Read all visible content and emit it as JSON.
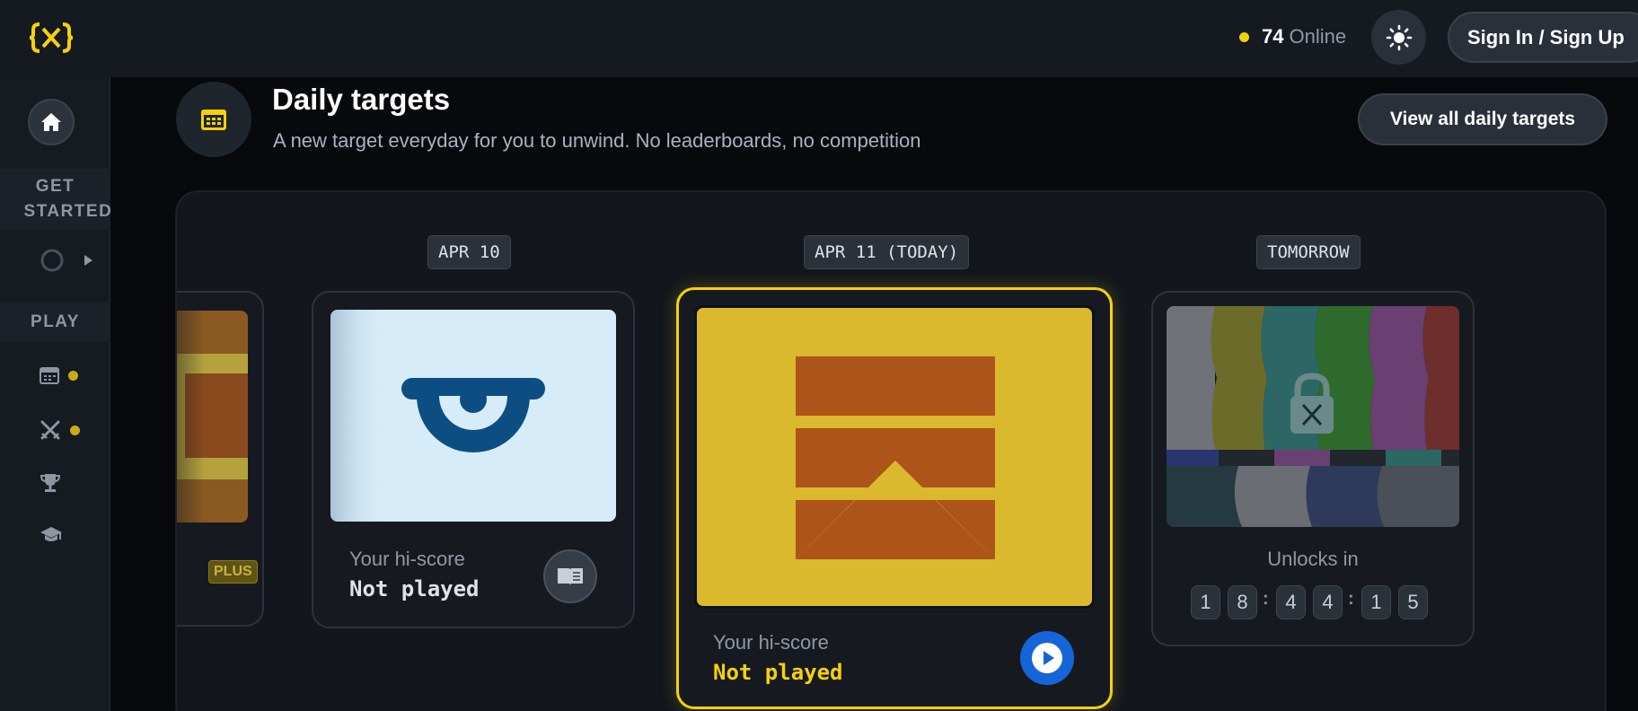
{
  "topbar": {
    "logo_alt": "{X}",
    "online_count": "74",
    "online_label": "Online",
    "signin_label": "Sign In / Sign Up"
  },
  "sidebar": {
    "get_started_label": "GET STARTED",
    "play_label": "PLAY"
  },
  "header": {
    "title": "Daily targets",
    "subtitle": "A new target everyday for you to unwind. No leaderboards, no competition",
    "view_all_label": "View all daily targets"
  },
  "cards": {
    "prev": {
      "badge": "PLUS"
    },
    "apr10": {
      "date": "APR 10",
      "score_label": "Your hi-score",
      "score_value": "Not played"
    },
    "today": {
      "date": "APR 11 (TODAY)",
      "score_label": "Your hi-score",
      "score_value": "Not played"
    },
    "tomorrow": {
      "date": "TOMORROW",
      "unlock_label": "Unlocks in",
      "digits": [
        "1",
        "8",
        "4",
        "4",
        "1",
        "5"
      ]
    }
  },
  "colors": {
    "accent_yellow": "#f5d10a",
    "play_blue": "#1565d8",
    "today_card_bg": "#dbb92e",
    "today_shape": "#ad5418",
    "apr10_bg": "#d6ecf9",
    "apr10_shape": "#0d4e82"
  },
  "icons": {
    "theme": "sun-icon",
    "home": "home-icon",
    "calendar": "calendar-icon",
    "swords": "swords-icon",
    "trophy": "trophy-icon",
    "graduation": "graduation-cap-icon",
    "book": "book-icon",
    "play": "play-icon",
    "lock": "lock-icon"
  }
}
